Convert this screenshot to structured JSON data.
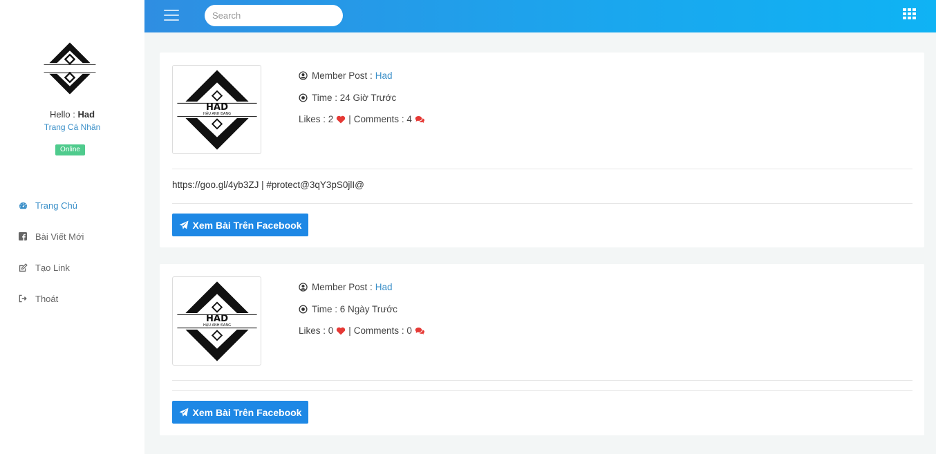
{
  "sidebar": {
    "hello_prefix": "Hello : ",
    "username": "Had",
    "profile_link": "Trang Cá Nhân",
    "status": "Online",
    "status_color": "#4fcb8d",
    "items": [
      {
        "label": "Trang Chủ",
        "icon": "dashboard-icon",
        "active": true
      },
      {
        "label": "Bài Viết Mới",
        "icon": "facebook-square-icon",
        "active": false
      },
      {
        "label": "Tạo Link",
        "icon": "edit-icon",
        "active": false
      },
      {
        "label": "Thoát",
        "icon": "sign-out-icon",
        "active": false
      }
    ]
  },
  "topbar": {
    "search_placeholder": "Search",
    "gradient_start": "#2f8ee2",
    "gradient_end": "#0fb3f4"
  },
  "posts": [
    {
      "member_label": "Member Post :",
      "author": "Had",
      "time_label": "Time : 24 Giờ Trước",
      "likes_label": "Likes : 2",
      "separator": "|",
      "comments_label": "Comments : 4",
      "content": "https://goo.gl/4yb3ZJ | #protect@3qY3pS0jlI@",
      "button_label": "Xem Bài Trên Facebook"
    },
    {
      "member_label": "Member Post :",
      "author": "Had",
      "time_label": "Time : 6 Ngày Trước",
      "likes_label": "Likes : 0",
      "separator": "|",
      "comments_label": "Comments : 0",
      "content": "",
      "button_label": "Xem Bài Trên Facebook"
    }
  ],
  "logo": {
    "text": "HAD",
    "subtext": "HẬU ANH ĐANG"
  },
  "colors": {
    "accent": "#3a8fc8",
    "button": "#1e88e5",
    "heart": "#e53935",
    "comment": "#e53935"
  }
}
